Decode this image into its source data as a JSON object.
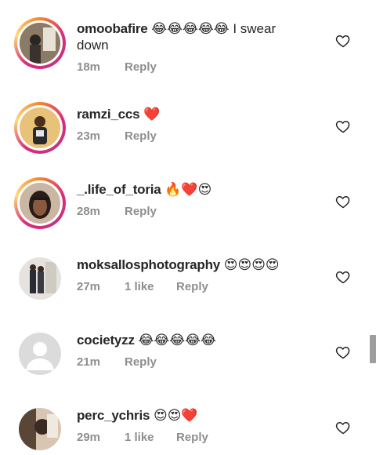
{
  "comments": [
    {
      "username": "omoobafire",
      "text": " 😂😂😂😂😂 I swear",
      "text2": "down",
      "time": "18m",
      "likes": "",
      "reply": "Reply",
      "avatar": "photo-ring"
    },
    {
      "username": "ramzi_ccs",
      "text": " ❤️",
      "time": "23m",
      "likes": "",
      "reply": "Reply",
      "avatar": "photo-ring"
    },
    {
      "username": "_.life_of_toria",
      "text": " 🔥❤️😍",
      "time": "28m",
      "likes": "",
      "reply": "Reply",
      "avatar": "photo-ring"
    },
    {
      "username": "moksallosphotography",
      "text": " 😍😍😍😍",
      "time": "27m",
      "likes": "1 like",
      "reply": "Reply",
      "avatar": "photo"
    },
    {
      "username": "cocietyzz",
      "text": " 😂😂😂😂😂",
      "time": "21m",
      "likes": "",
      "reply": "Reply",
      "avatar": "default"
    },
    {
      "username": "perc_ychris",
      "text": " 😍😍❤️",
      "time": "29m",
      "likes": "1 like",
      "reply": "Reply",
      "avatar": "photo"
    }
  ],
  "icons": {
    "like": "heart-outline-icon"
  },
  "colors": {
    "meta": "#8e8e8e",
    "text": "#262626",
    "ring_start": "#f58529",
    "ring_end": "#dd2a7b"
  }
}
